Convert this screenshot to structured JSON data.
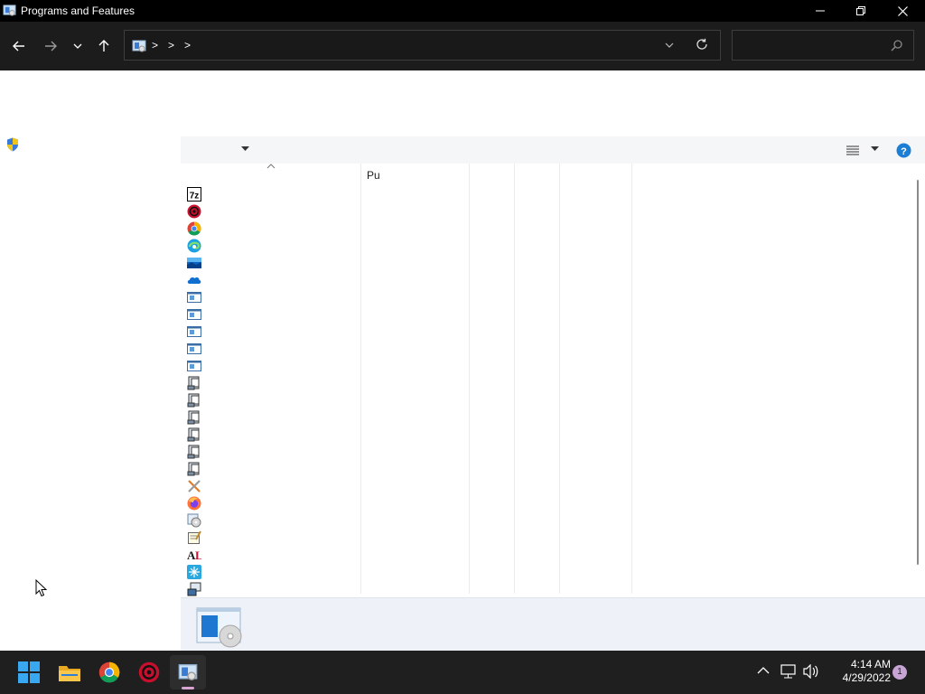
{
  "window": {
    "title": "Programs and Features",
    "controls": [
      "minimize",
      "restore",
      "close"
    ]
  },
  "navigation": {
    "back_icon": "arrow-left-icon",
    "forward_icon": "arrow-right-icon",
    "recent_icon": "chevron-down-icon",
    "up_icon": "arrow-up-icon",
    "address": {
      "location_icon": "control-panel-icon",
      "separators": [
        ">",
        ">",
        ">"
      ]
    },
    "search": {
      "placeholder": ""
    }
  },
  "left_pane": {
    "shield_icon": "uac-shield-icon"
  },
  "command_bar": {
    "organize_dropdown_icon": "chevron-down-icon",
    "view_icon": "details-view-icon",
    "help_icon": "help-icon"
  },
  "list": {
    "columns": [
      {
        "label": ""
      },
      {
        "label": "Pu"
      },
      {
        "label": ""
      },
      {
        "label": ""
      },
      {
        "label": ""
      }
    ],
    "rows": [
      {
        "icon": "7zip-icon"
      },
      {
        "icon": "red-gear-icon"
      },
      {
        "icon": "chrome-icon"
      },
      {
        "icon": "edge-icon"
      },
      {
        "icon": "landscape-app-icon"
      },
      {
        "icon": "onedrive-icon"
      },
      {
        "icon": "generic-program-icon"
      },
      {
        "icon": "generic-program-icon"
      },
      {
        "icon": "generic-program-icon"
      },
      {
        "icon": "generic-program-icon"
      },
      {
        "icon": "generic-program-icon"
      },
      {
        "icon": "installer-icon"
      },
      {
        "icon": "installer-icon"
      },
      {
        "icon": "installer-icon"
      },
      {
        "icon": "installer-icon"
      },
      {
        "icon": "installer-icon"
      },
      {
        "icon": "installer-icon"
      },
      {
        "icon": "x-tool-icon"
      },
      {
        "icon": "firefox-icon"
      },
      {
        "icon": "setup-disc-icon"
      },
      {
        "icon": "notepad-icon"
      },
      {
        "icon": "al-icon"
      },
      {
        "icon": "blue-snowflake-icon"
      },
      {
        "icon": "network-installer-icon"
      }
    ]
  },
  "details_pane": {
    "icon": "program-disc-icon"
  },
  "taskbar": {
    "items": [
      {
        "name": "start",
        "icon": "windows-logo-icon"
      },
      {
        "name": "file-explorer",
        "icon": "folder-icon"
      },
      {
        "name": "chrome",
        "icon": "chrome-icon"
      },
      {
        "name": "red-app",
        "icon": "red-gear-icon"
      },
      {
        "name": "control-panel",
        "icon": "control-panel-icon",
        "active": true
      }
    ],
    "tray": {
      "time": "4:14 AM",
      "date": "4/29/2022",
      "notification_count": "1"
    }
  },
  "colors": {
    "titlebar": "#000000",
    "navbar": "#1c1c1c",
    "command_bar": "#f4f6f8",
    "details_pane": "#eef2f8",
    "taskbar": "#1f1f1f",
    "help_blue": "#1a7fd4"
  }
}
